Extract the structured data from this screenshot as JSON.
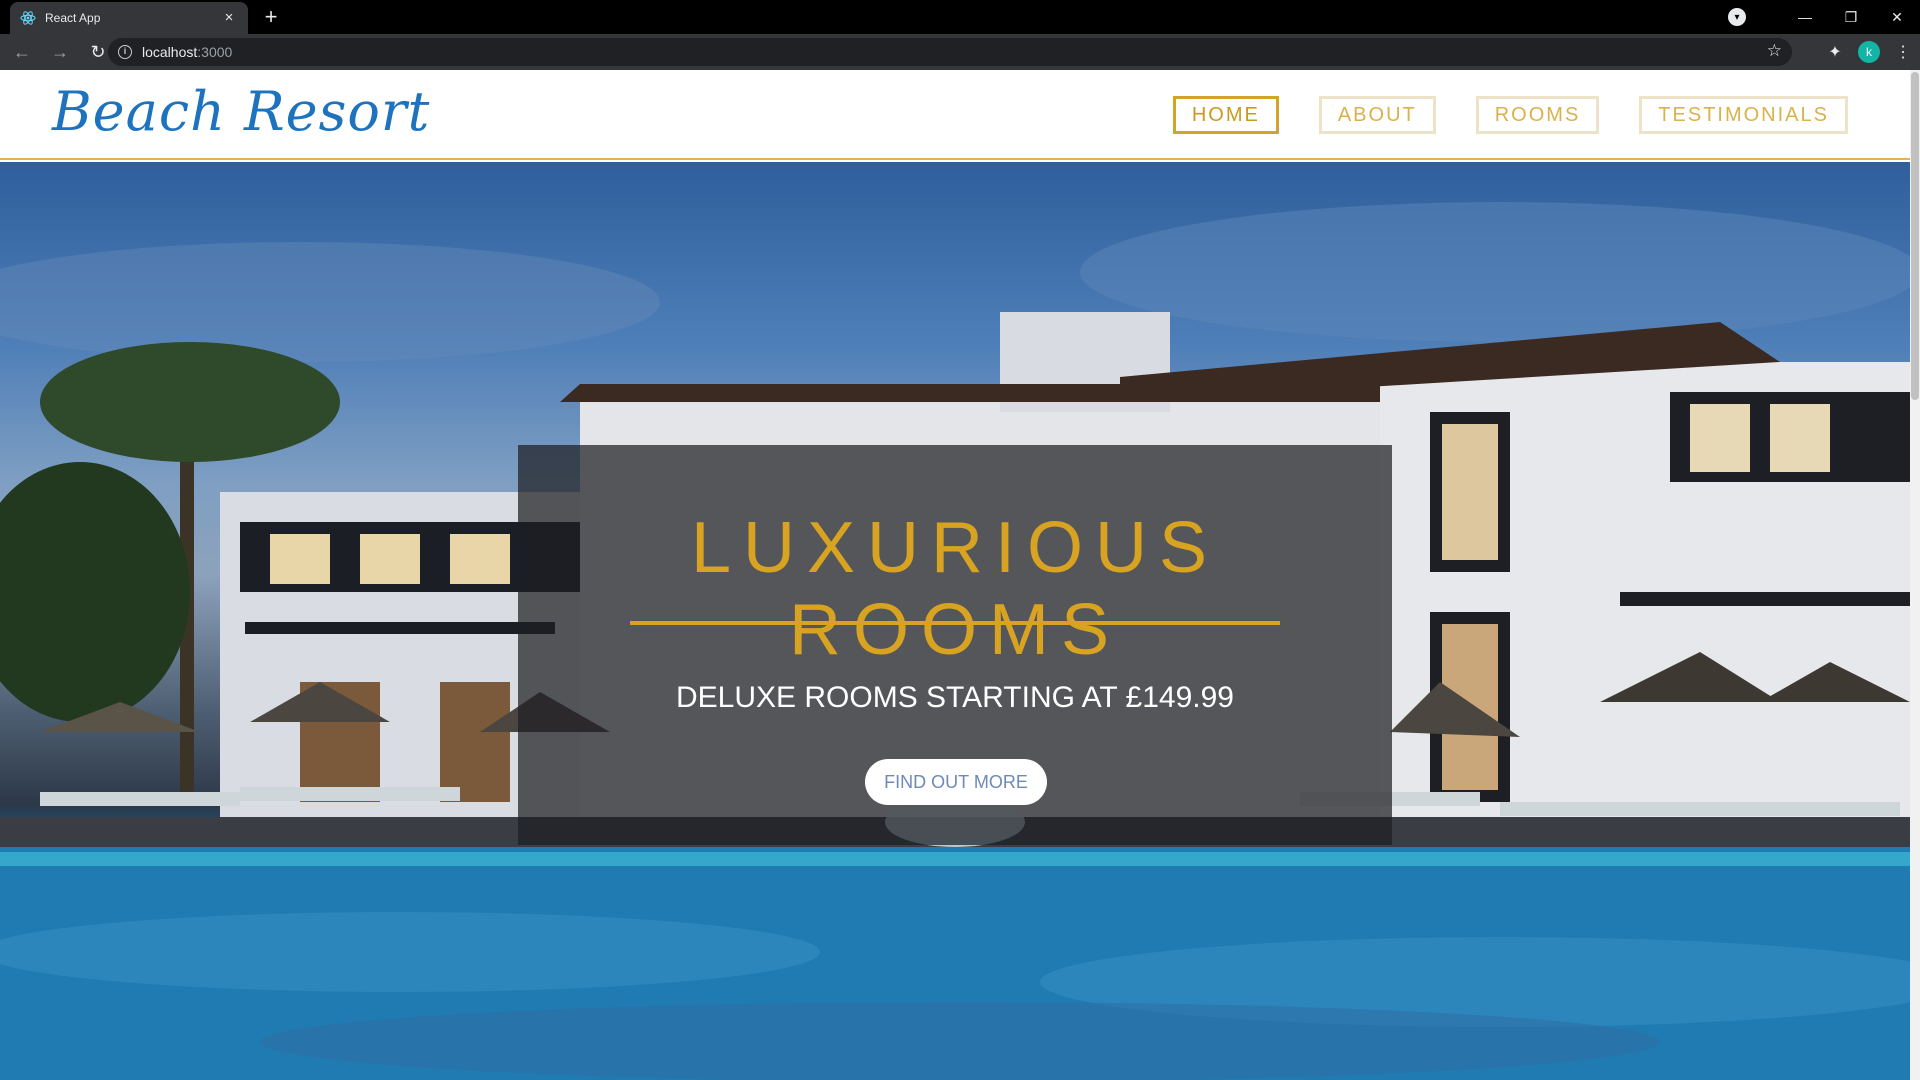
{
  "browser": {
    "tab_title": "React App",
    "tab_close": "×",
    "new_tab": "+",
    "url_host": "localhost",
    "url_port": ":3000",
    "avatar_letter": "k",
    "back": "←",
    "forward": "→",
    "reload": "↻",
    "minimize": "—",
    "restore": "❐",
    "close": "✕",
    "star": "☆",
    "extensions": "✦",
    "menu": "⋮"
  },
  "site": {
    "logo": "Beach Resort",
    "nav": [
      {
        "label": "HOME",
        "active": true
      },
      {
        "label": "ABOUT",
        "active": false
      },
      {
        "label": "ROOMS",
        "active": false
      },
      {
        "label": "TESTIMONIALS",
        "active": false
      }
    ]
  },
  "hero": {
    "title": "LUXURIOUS ROOMS",
    "subtitle": "DELUXE ROOMS STARTING AT £149.99",
    "button": "FIND OUT MORE"
  },
  "colors": {
    "brand_blue": "#1e73be",
    "gold": "#d9a322",
    "chrome_dark": "#35363a"
  }
}
